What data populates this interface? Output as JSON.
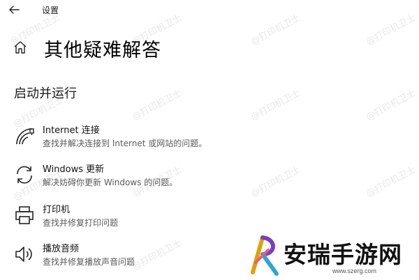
{
  "window": {
    "title": "设置"
  },
  "page": {
    "title": "其他疑难解答"
  },
  "section": {
    "heading": "启动并运行"
  },
  "items": [
    {
      "icon": "wifi-icon",
      "label": "Internet 连接",
      "desc": "查找并解决连接到 Internet 或网站的问题。"
    },
    {
      "icon": "sync-icon",
      "label": "Windows 更新",
      "desc": "解决妨碍你更新 Windows 的问题。"
    },
    {
      "icon": "printer-icon",
      "label": "打印机",
      "desc": "查找并修复打印问题"
    },
    {
      "icon": "speaker-icon",
      "label": "播放音频",
      "desc": "查找并修复播放声音问题"
    }
  ],
  "watermark": {
    "text": "@打印机卫士"
  },
  "brand": {
    "name": "安瑞手游网",
    "url": "www.szerg.com"
  }
}
